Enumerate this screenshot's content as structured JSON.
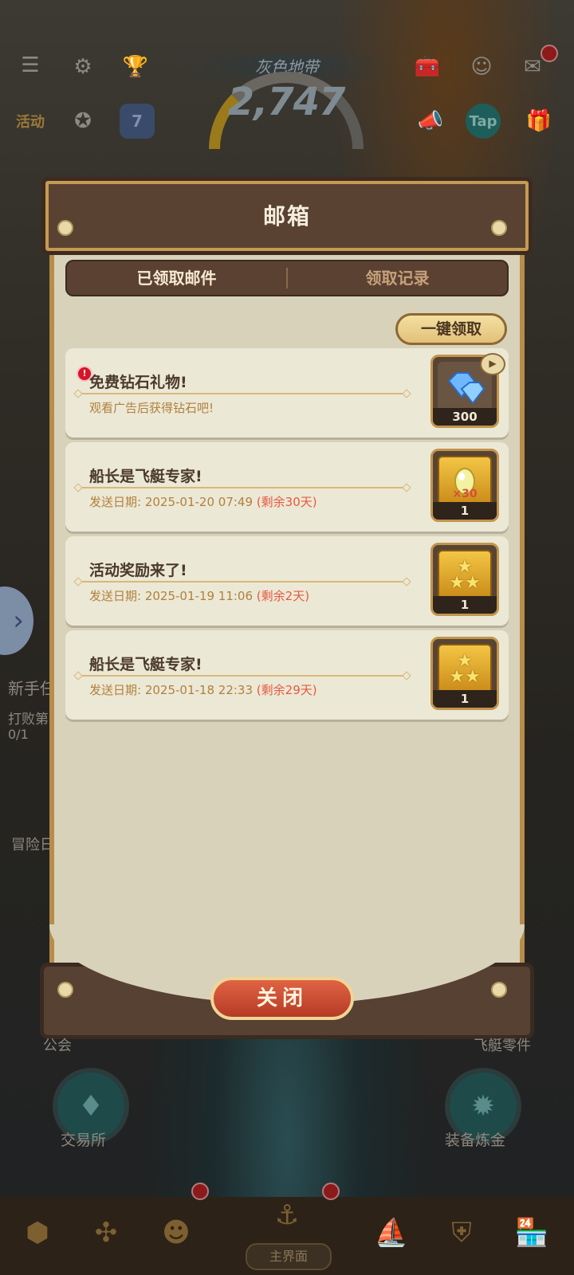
{
  "hud": {
    "zone_label": "灰色地带",
    "score": "2,747",
    "icons": [
      "menu-icon",
      "gear-icon",
      "trophy-icon",
      "event-icon",
      "compass-icon",
      "calendar-icon",
      "toolbox-icon",
      "friends-icon",
      "mail-icon",
      "announcement-icon",
      "tap-icon",
      "gift-icon"
    ],
    "event_label": "活动",
    "calendar_day": "7",
    "tap_label": "Tap"
  },
  "background_text": {
    "left_new": "新手任",
    "left_defeat": "打败第",
    "left_progress": "0/1",
    "left_adventure": "冒险日",
    "guild": "公会",
    "parts": "飞艇零件",
    "exchange": "交易所",
    "refine": "装备炼金",
    "home_tab": "主界面"
  },
  "modal": {
    "title": "邮箱",
    "tabs": [
      {
        "label": "已领取邮件",
        "active": true
      },
      {
        "label": "领取记录",
        "active": false
      }
    ],
    "claim_all": "一键领取",
    "close": "关闭",
    "mails": [
      {
        "title": "免费钻石礼物!",
        "subtitle": "观看广告后获得钻石吧!",
        "date": "",
        "remain": "",
        "reward": "diamond-icon",
        "count": "300",
        "has_alert": true,
        "has_video": true
      },
      {
        "title": "船长是飞艇专家!",
        "subtitle": "发送日期:",
        "date": "2025-01-20 07:49",
        "remain": "(剩余30天)",
        "reward": "egg-card-icon",
        "multiplier": "×30",
        "count": "1"
      },
      {
        "title": "活动奖励来了!",
        "subtitle": "发送日期:",
        "date": "2025-01-19 11:06",
        "remain": "(剩余2天)",
        "reward": "star-card-icon",
        "count": "1"
      },
      {
        "title": "船长是飞艇专家!",
        "subtitle": "发送日期:",
        "date": "2025-01-18 22:33",
        "remain": "(剩余29天)",
        "reward": "star-card-icon",
        "count": "1"
      }
    ]
  },
  "colors": {
    "panel": "#d8d2bb",
    "header": "#5a4233",
    "accent_gold": "#c59a52",
    "remain_red": "#e55a3f",
    "date_gold": "#b0813c",
    "close_red": "#c94a2f"
  }
}
